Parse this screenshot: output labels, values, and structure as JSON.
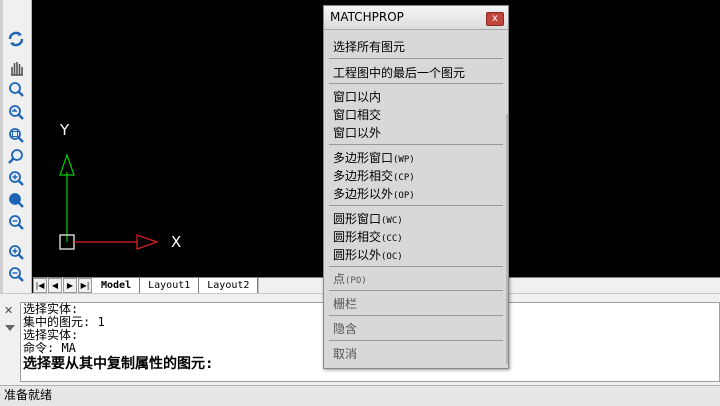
{
  "canvas": {
    "y_axis_label": "Y",
    "x_axis_label": "X"
  },
  "layout_tabs": [
    "Model",
    "Layout1",
    "Layout2"
  ],
  "command_window": {
    "lines": [
      "选择实体:",
      "集中的图元: 1",
      "选择实体:",
      "命令: MA"
    ],
    "prompt": "选择要从其中复制属性的图元:"
  },
  "status_bar": {
    "text": "准备就绪"
  },
  "popup": {
    "title": "MATCHPROP",
    "close_label": "x",
    "items": [
      {
        "label": "选择所有图元",
        "code": ""
      },
      {
        "label": "工程图中的最后一个图元",
        "code": ""
      },
      {
        "label": "窗口以内",
        "code": ""
      },
      {
        "label": "窗口相交",
        "code": ""
      },
      {
        "label": "窗口以外",
        "code": ""
      },
      {
        "label": "多边形窗口",
        "code": "(WP)"
      },
      {
        "label": "多边形相交",
        "code": "(CP)"
      },
      {
        "label": "多边形以外",
        "code": "(OP)"
      },
      {
        "label": "圆形窗口",
        "code": "(WC)"
      },
      {
        "label": "圆形相交",
        "code": "(CC)"
      },
      {
        "label": "圆形以外",
        "code": "(OC)"
      },
      {
        "label": "点",
        "code": "(PO)"
      },
      {
        "label": "栅栏",
        "code": ""
      },
      {
        "label": "隐含",
        "code": ""
      },
      {
        "label": "取消",
        "code": ""
      }
    ]
  },
  "colors": {
    "canvas_bg": "#000000",
    "y_axis": "#00cc00",
    "x_axis": "#e02020",
    "toolbar_icon": "#1e64b4"
  }
}
